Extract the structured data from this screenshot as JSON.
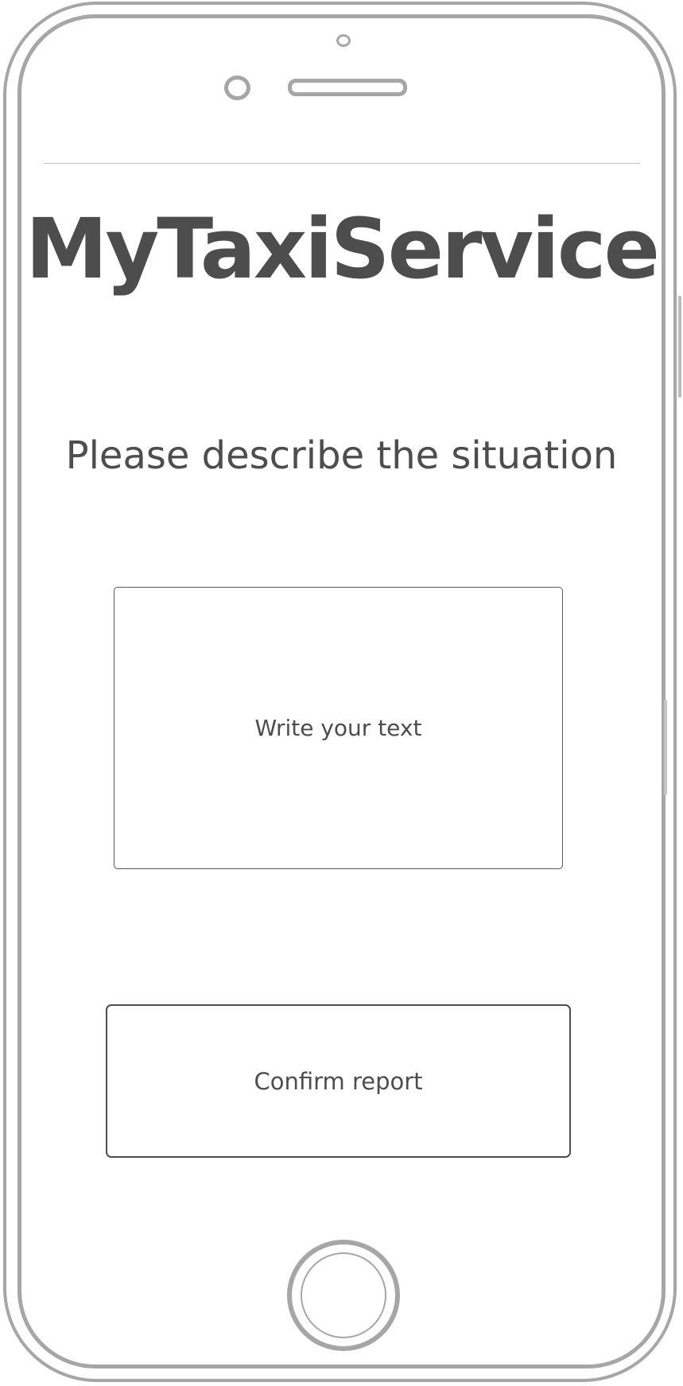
{
  "app": {
    "title": "MyTaxiService"
  },
  "report": {
    "prompt": "Please describe the situation",
    "text_placeholder": "Write your text",
    "confirm_label": "Confirm report"
  },
  "colors": {
    "text": "#4d4d4d",
    "frame": "#a6a6a6",
    "background": "#ffffff"
  }
}
